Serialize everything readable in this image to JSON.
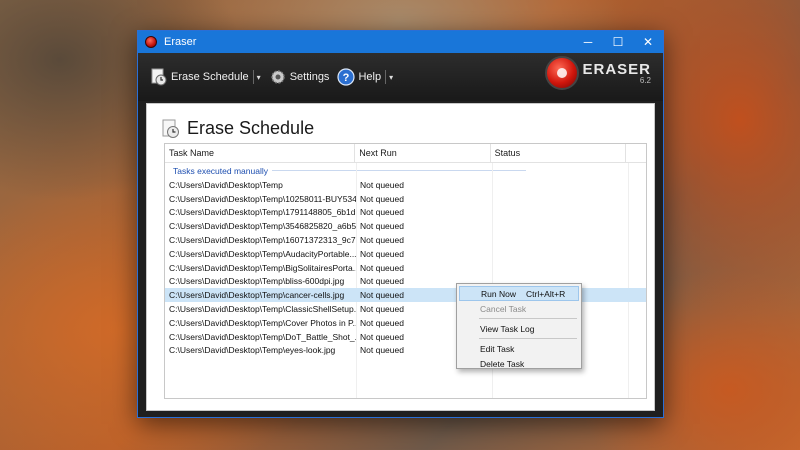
{
  "window": {
    "title": "Eraser"
  },
  "window_controls": {
    "minimize": "─",
    "maximize": "☐",
    "close": "✕"
  },
  "toolbar": {
    "erase_schedule": "Erase Schedule",
    "settings": "Settings",
    "help": "Help",
    "dropdown_glyph": "▾"
  },
  "logo": {
    "name": "ERASER",
    "version": "6.2"
  },
  "page": {
    "title": "Erase Schedule"
  },
  "columns": {
    "task_name": "Task Name",
    "next_run": "Next Run",
    "status": "Status"
  },
  "group": {
    "label": "Tasks executed manually"
  },
  "tasks": [
    {
      "name": "C:\\Users\\David\\Desktop\\Temp",
      "next_run": "Not queued",
      "status": ""
    },
    {
      "name": "C:\\Users\\David\\Desktop\\Temp\\10258011-BUY534...",
      "next_run": "Not queued",
      "status": ""
    },
    {
      "name": "C:\\Users\\David\\Desktop\\Temp\\1791148805_6b1d...",
      "next_run": "Not queued",
      "status": ""
    },
    {
      "name": "C:\\Users\\David\\Desktop\\Temp\\3546825820_a6b5f...",
      "next_run": "Not queued",
      "status": ""
    },
    {
      "name": "C:\\Users\\David\\Desktop\\Temp\\16071372313_9c7...",
      "next_run": "Not queued",
      "status": ""
    },
    {
      "name": "C:\\Users\\David\\Desktop\\Temp\\AudacityPortable...",
      "next_run": "Not queued",
      "status": ""
    },
    {
      "name": "C:\\Users\\David\\Desktop\\Temp\\BigSolitairesPorta...",
      "next_run": "Not queued",
      "status": ""
    },
    {
      "name": "C:\\Users\\David\\Desktop\\Temp\\bliss-600dpi.jpg",
      "next_run": "Not queued",
      "status": ""
    },
    {
      "name": "C:\\Users\\David\\Desktop\\Temp\\cancer-cells.jpg",
      "next_run": "Not queued",
      "status": ""
    },
    {
      "name": "C:\\Users\\David\\Desktop\\Temp\\ClassicShellSetup...",
      "next_run": "Not queued",
      "status": ""
    },
    {
      "name": "C:\\Users\\David\\Desktop\\Temp\\Cover Photos in P...",
      "next_run": "Not queued",
      "status": ""
    },
    {
      "name": "C:\\Users\\David\\Desktop\\Temp\\DoT_Battle_Shot_...",
      "next_run": "Not queued",
      "status": ""
    },
    {
      "name": "C:\\Users\\David\\Desktop\\Temp\\eyes-look.jpg",
      "next_run": "Not queued",
      "status": ""
    }
  ],
  "selected_row_index": 8,
  "context_menu": {
    "run_now": "Run Now",
    "run_now_shortcut": "Ctrl+Alt+R",
    "cancel_task": "Cancel Task",
    "view_task_log": "View Task Log",
    "edit_task": "Edit Task",
    "delete_task": "Delete Task"
  },
  "colors": {
    "title_bar": "#1976d9",
    "selection": "#cce4f7",
    "group_text": "#1e4fb0"
  }
}
